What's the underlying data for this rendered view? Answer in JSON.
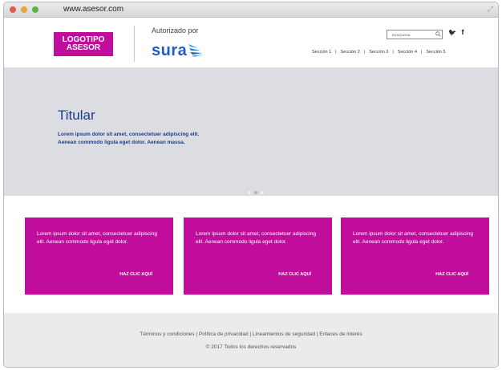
{
  "browser": {
    "url": "www.asesor.com"
  },
  "header": {
    "logo_line1": "LOGOTIPO",
    "logo_line2": "ASESOR",
    "authorized_label": "Autorizado por",
    "brand": "sura",
    "search_placeholder": "BÚSQUEDA",
    "nav": [
      "Sección 1",
      "Sección 2",
      "Sección 3",
      "Sección 4",
      "Sección 5"
    ],
    "social": [
      "twitter",
      "facebook"
    ],
    "social_glyphs": {
      "twitter": "🐦",
      "facebook": "f"
    }
  },
  "hero": {
    "title": "Titular",
    "text": "Lorem ipsum dolor sit amet, consectetuer adipiscing elit. Aenean commodo ligula eget dolor. Aenean massa.",
    "slides": 3,
    "active_slide": 1
  },
  "cards": [
    {
      "text": "Lorem ipsum dolor sit amet, consectetuer adipiscing elit. Aenean commodo ligula eget dolor.",
      "link": "HAZ CLIC AQUÍ"
    },
    {
      "text": "Lorem ipsum dolor sit amet, consectetuer adipiscing elit. Aenean commodo ligula eget dolor.",
      "link": "HAZ CLIC AQUÍ"
    },
    {
      "text": "Lorem ipsum dolor sit amet, consectetuer adipiscing elit. Aenean commodo ligula eget dolor.",
      "link": "HAZ CLIC AQUÍ"
    }
  ],
  "footer": {
    "links": "Términos y condiciones | Política de privacidad | Lineamientos de seguridad | Enlaces de interés",
    "copyright": "© 2017 Todos los derechos reservados"
  },
  "colors": {
    "magenta": "#c00d9b",
    "navy": "#1b3c8c",
    "sura_blue": "#1e5bc6",
    "hero_bg": "#dcdde2",
    "footer_bg": "#ebebeb"
  }
}
